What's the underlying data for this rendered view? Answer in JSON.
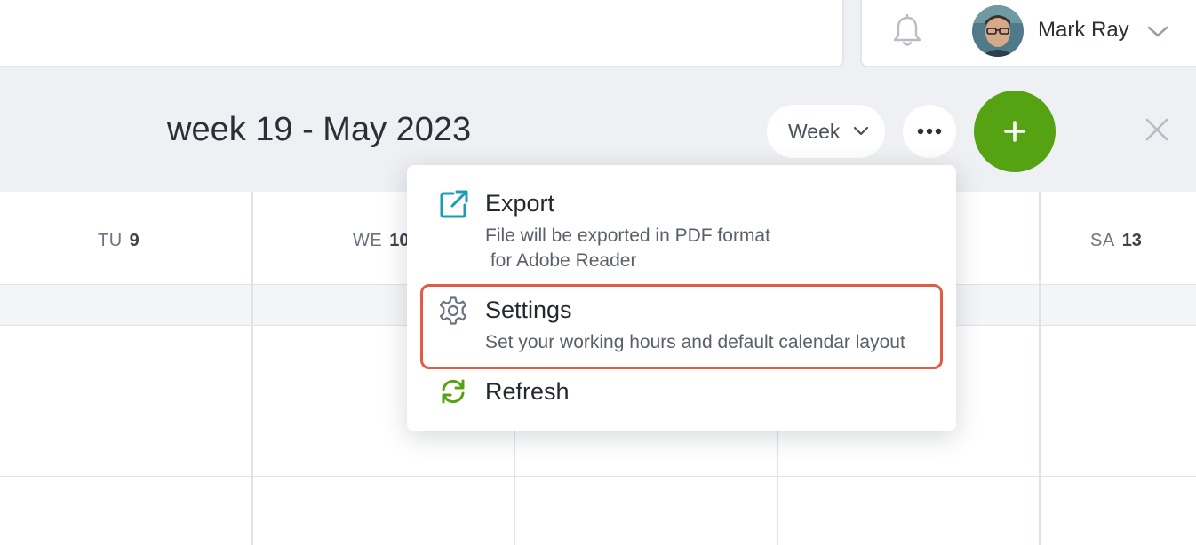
{
  "header": {
    "user": {
      "name": "Mark Ray"
    }
  },
  "toolbar": {
    "title": "week 19 - May 2023",
    "view_label": "Week"
  },
  "calendar": {
    "days": [
      {
        "name": "TU",
        "date": "9"
      },
      {
        "name": "WE",
        "date": "10"
      },
      {
        "name": "SA",
        "date": "13"
      }
    ]
  },
  "menu": {
    "items": [
      {
        "label": "Export",
        "description": "File will be exported in PDF format\n for Adobe Reader",
        "icon": "external-link-icon"
      },
      {
        "label": "Settings",
        "description": "Set your working hours and default calendar layout",
        "icon": "gear-icon"
      },
      {
        "label": "Refresh",
        "icon": "refresh-icon"
      }
    ]
  },
  "colors": {
    "accent_green": "#55a312",
    "highlight": "#e25b45",
    "export_icon": "#1a9bb8"
  }
}
